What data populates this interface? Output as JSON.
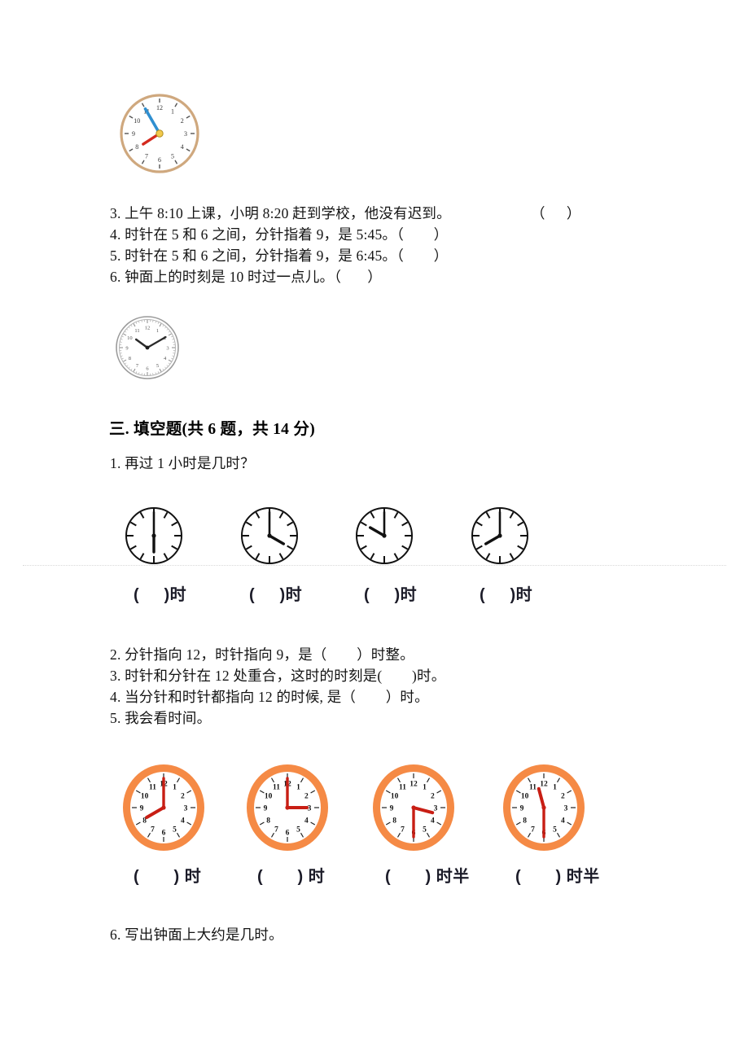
{
  "document": {
    "type": "math-worksheet",
    "language": "zh-CN"
  },
  "true_false_questions": [
    {
      "id": "3",
      "text": "3. 上午 8:10 上课，小明 8:20 赶到学校，他没有迟到。",
      "bracket": "（      ）"
    },
    {
      "id": "4",
      "text": "4. 时针在 5 和 6 之间，分针指着 9，是 5:45。（        ）",
      "bracket": ""
    },
    {
      "id": "5",
      "text": "5. 时针在 5 和 6 之间，分针指着 9，是 6:45。（        ）",
      "bracket": ""
    },
    {
      "id": "6",
      "text": "6. 钟面上的时刻是 10 时过一点儿。（       ）",
      "bracket": ""
    }
  ],
  "section": {
    "title": "三. 填空题(共 6 题，共 14 分)"
  },
  "fill_questions": [
    {
      "id": "1",
      "text": "1. 再过 1 小时是几时？"
    },
    {
      "id": "2",
      "text": "2. 分针指向 12，时针指向 9，是（        ）时整。"
    },
    {
      "id": "3",
      "text": "3. 时针和分针在 12 处重合，这时的时刻是(        )时。"
    },
    {
      "id": "4",
      "text": "4. 当分针和时针都指向 12 的时候, 是（        ）时。"
    },
    {
      "id": "5",
      "text": "5. 我会看时间。"
    },
    {
      "id": "6",
      "text": "6. 写出钟面上大约是几时。"
    }
  ],
  "answer_rows": {
    "line_clocks": [
      {
        "label": "(     )时"
      },
      {
        "label": "(     )时"
      },
      {
        "label": "(     )时"
      },
      {
        "label": "(     )时"
      }
    ],
    "orange_clocks": [
      {
        "label": "(       ) 时"
      },
      {
        "label": "(       ) 时"
      },
      {
        "label": "(       ) 时半"
      },
      {
        "label": "(       ) 时半"
      }
    ]
  },
  "clocks": {
    "top_color_clock": {
      "name": "color-clock-top",
      "hour": 7.9,
      "minute": 55,
      "rim_color": "#cfa87e",
      "hour_hand_color": "#d42a1e",
      "minute_hand_color": "#2f8fd0",
      "center_color": "#f2c94c"
    },
    "gray_clock": {
      "name": "gray-clock",
      "hour": 10.2,
      "minute": 10,
      "rim_color": "#8a8a8a",
      "hand_color": "#2a2a2a"
    },
    "line_clocks": [
      {
        "name": "line-clock-1",
        "hour": 6,
        "minute": 0
      },
      {
        "name": "line-clock-2",
        "hour": 4,
        "minute": 0
      },
      {
        "name": "line-clock-3",
        "hour": 10,
        "minute": 0
      },
      {
        "name": "line-clock-4",
        "hour": 8,
        "minute": 0
      }
    ],
    "orange_clocks": [
      {
        "name": "orange-clock-1",
        "hour": 8,
        "minute": 0
      },
      {
        "name": "orange-clock-2",
        "hour": 3,
        "minute": 0
      },
      {
        "name": "orange-clock-3",
        "hour": 3.5,
        "minute": 30
      },
      {
        "name": "orange-clock-4",
        "hour": 11.5,
        "minute": 30
      }
    ],
    "numerals": [
      "12",
      "1",
      "2",
      "3",
      "4",
      "5",
      "6",
      "7",
      "8",
      "9",
      "10",
      "11"
    ],
    "orange_rim_color": "#f58a45",
    "orange_hand_color": "#c81e14",
    "line_clock_stroke": "#111111"
  }
}
